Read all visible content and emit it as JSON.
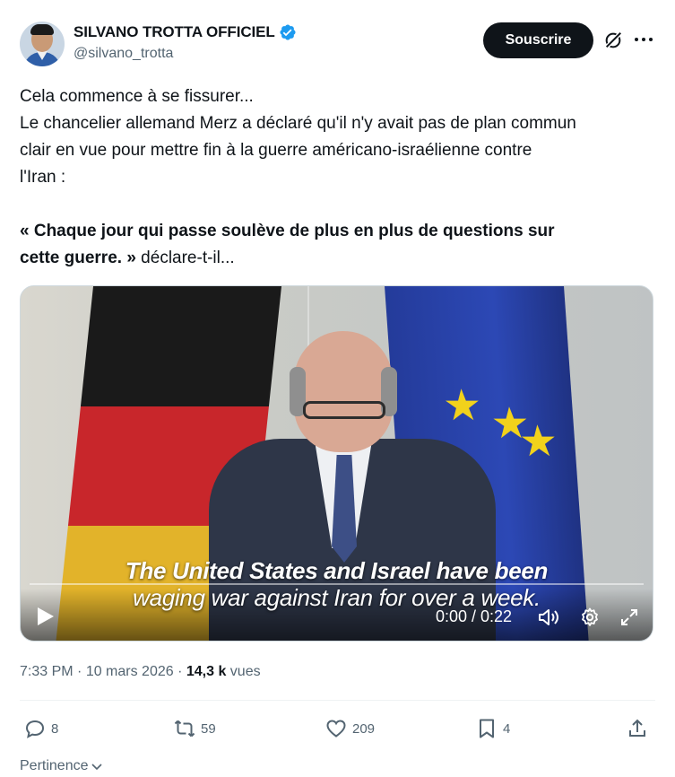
{
  "author": {
    "display_name": "SILVANO TROTTA OFFICIEL",
    "handle": "@silvano_trotta"
  },
  "header": {
    "subscribe_label": "Souscrire"
  },
  "post": {
    "lines": [
      "Cela commence à se fissurer...",
      "Le chancelier allemand Merz a déclaré qu'il n'y avait pas de plan commun",
      "clair en vue pour mettre fin à la guerre américano-israélienne contre",
      "l'Iran :"
    ],
    "quote_bold_1": "« Chaque jour qui passe soulève de plus en plus de questions sur",
    "quote_bold_2": "cette guerre. »",
    "quote_tail": " déclare-t-il..."
  },
  "video": {
    "caption_line_1": "The United States and Israel have been",
    "caption_line_2": "waging war against Iran for over a week.",
    "time": "0:00 / 0:22",
    "progress": 0
  },
  "meta": {
    "time": "7:33 PM",
    "sep1": " · ",
    "date": "10 mars 2026",
    "sep2": " · ",
    "views_count": "14,3 k",
    "views_label": " vues"
  },
  "actions": {
    "replies": "8",
    "reposts": "59",
    "likes": "209",
    "bookmarks": "4"
  },
  "sort": {
    "label": "Pertinence"
  },
  "colors": {
    "text": "#0f1419",
    "secondary": "#536471",
    "verified": "#1d9bf0",
    "button_bg": "#0f1419"
  }
}
